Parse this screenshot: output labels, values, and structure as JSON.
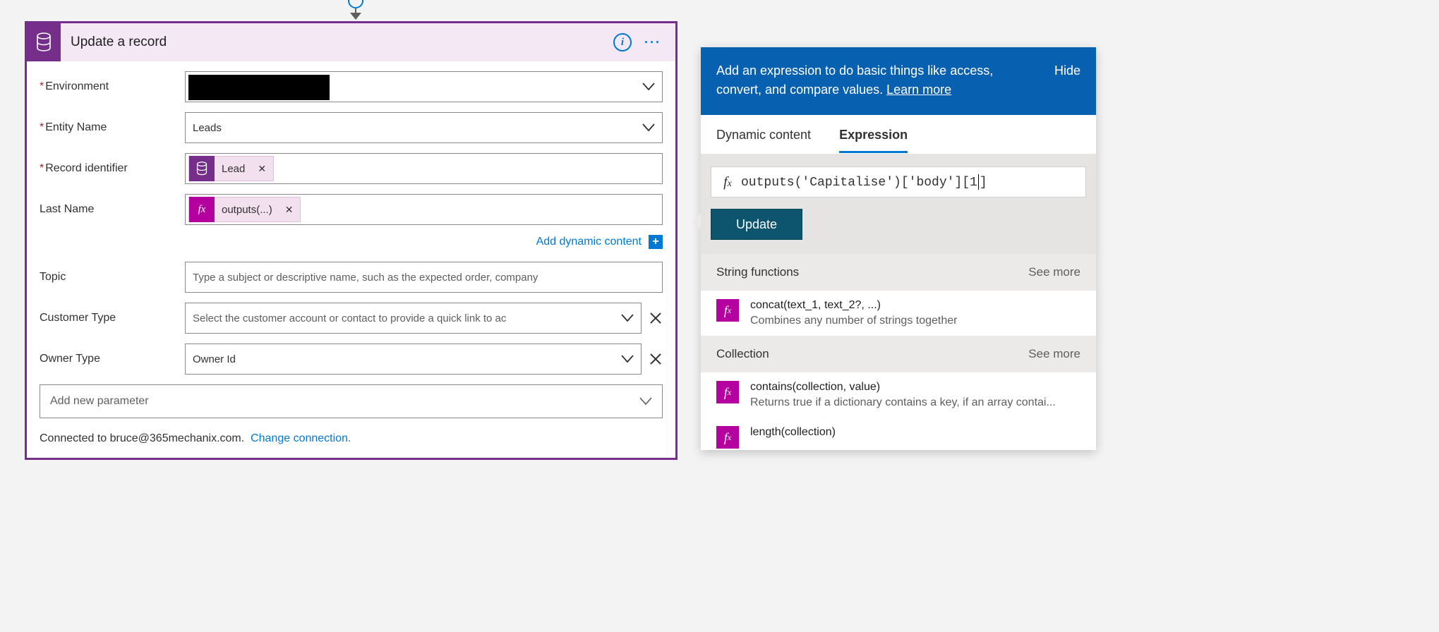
{
  "card": {
    "title": "Update a record",
    "info_icon_label": "i",
    "more_icon_label": "···",
    "fields": {
      "environment": {
        "label": "Environment",
        "required": true,
        "value": ""
      },
      "entity": {
        "label": "Entity Name",
        "required": true,
        "value": "Leads"
      },
      "record_id": {
        "label": "Record identifier",
        "required": true,
        "token_label": "Lead"
      },
      "last_name": {
        "label": "Last Name",
        "required": false,
        "token_label": "outputs(...)"
      },
      "topic": {
        "label": "Topic",
        "required": false,
        "placeholder": "Type a subject or descriptive name, such as the expected order, company"
      },
      "customer_type": {
        "label": "Customer Type",
        "required": false,
        "placeholder": "Select the customer account or contact to provide a quick link to ac"
      },
      "owner_type": {
        "label": "Owner Type",
        "required": false,
        "value": "Owner Id"
      }
    },
    "add_dynamic_label": "Add dynamic content",
    "add_param_placeholder": "Add new parameter",
    "connection_text": "Connected to bruce@365mechanix.com.",
    "change_conn_label": "Change connection."
  },
  "panel": {
    "intro_text": "Add an expression to do basic things like access, convert, and compare values. ",
    "learn_more": "Learn more",
    "hide_label": "Hide",
    "tabs": {
      "dynamic": "Dynamic content",
      "expression": "Expression"
    },
    "expression_value": "outputs('Capitalise')['body'][1]",
    "update_label": "Update",
    "sections": [
      {
        "title": "String functions",
        "see_more": "See more",
        "items": [
          {
            "sig": "concat(text_1, text_2?, ...)",
            "desc": "Combines any number of strings together"
          }
        ]
      },
      {
        "title": "Collection",
        "see_more": "See more",
        "items": [
          {
            "sig": "contains(collection, value)",
            "desc": "Returns true if a dictionary contains a key, if an array contai..."
          },
          {
            "sig": "length(collection)",
            "desc": ""
          }
        ]
      }
    ]
  }
}
